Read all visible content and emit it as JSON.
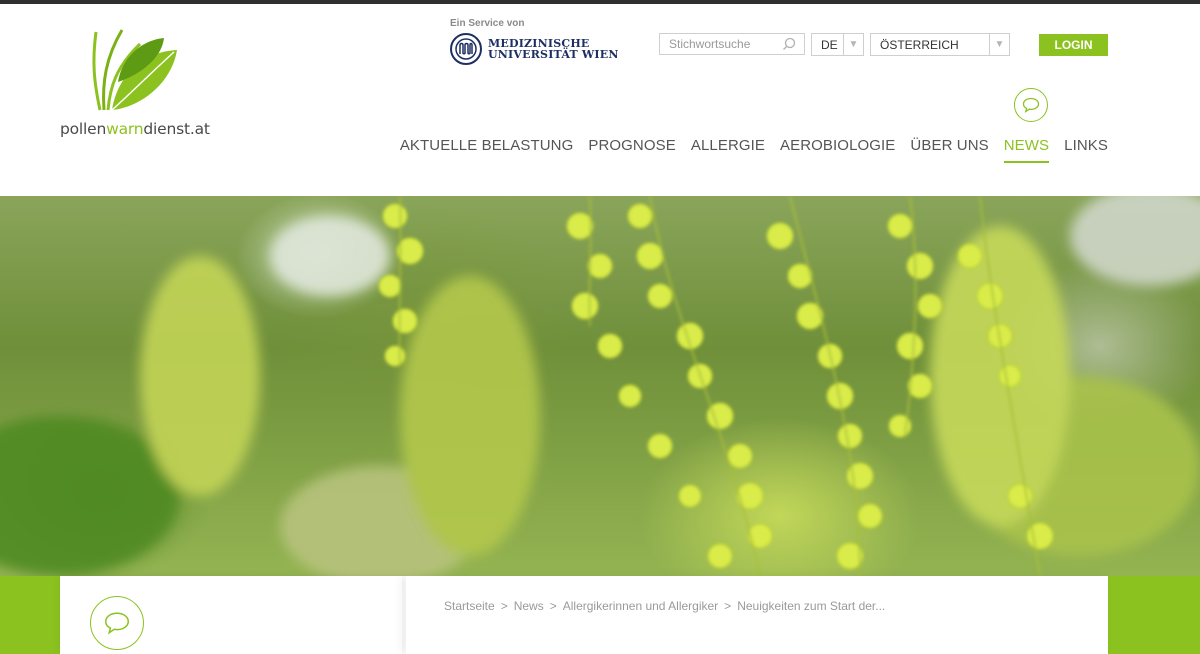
{
  "logo": {
    "text_a": "pollen",
    "text_b": "warn",
    "text_c": "dienst.at"
  },
  "service": {
    "label": "Ein Service von",
    "name_line1": "MEDIZINISCHE",
    "name_line2": "UNIVERSITÄT WIEN"
  },
  "search": {
    "placeholder": "Stichwortsuche",
    "icon": "search-icon"
  },
  "language_select": {
    "value": "DE"
  },
  "country_select": {
    "value": "ÖSTERREICH"
  },
  "login": {
    "label": "LOGIN"
  },
  "nav": {
    "items": [
      {
        "label": "AKTUELLE BELASTUNG"
      },
      {
        "label": "PROGNOSE"
      },
      {
        "label": "ALLERGIE"
      },
      {
        "label": "AEROBIOLOGIE"
      },
      {
        "label": "ÜBER UNS"
      },
      {
        "label": "NEWS"
      },
      {
        "label": "LINKS"
      }
    ],
    "active": "NEWS",
    "active_icon": "speech-bubble-icon"
  },
  "breadcrumb": {
    "items": [
      "Startseite",
      "News",
      "Allergikerinnen und Allergiker",
      "Neuigkeiten zum Start der..."
    ],
    "separator": ">"
  },
  "colors": {
    "accent": "#8cc21f",
    "text": "#555555",
    "university": "#1e2e63"
  }
}
